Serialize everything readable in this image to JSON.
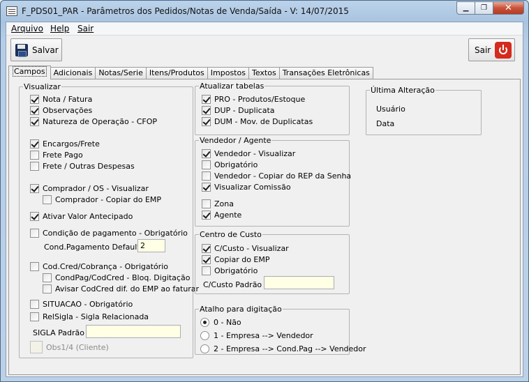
{
  "window": {
    "title": "F_PDS01_PAR - Parâmetros dos Pedidos/Notas de Venda/Saída - V: 14/07/2015",
    "minimize_glyph": "▁",
    "maximize_glyph": "❐",
    "close_glyph": "✕"
  },
  "menu": {
    "file": "Arquivo",
    "help": "Help",
    "exit": "Sair"
  },
  "toolbar": {
    "save_label": "Salvar",
    "exit_label": "Sair"
  },
  "tabs": [
    "Campos",
    "Adicionais",
    "Notas/Serie",
    "Itens/Produtos",
    "Impostos",
    "Textos",
    "Transações Eletrônicas"
  ],
  "visualizar": {
    "legend": "Visualizar",
    "items": [
      {
        "label": "Nota / Fatura",
        "checked": true
      },
      {
        "label": "Observações",
        "checked": true
      },
      {
        "label": "Natureza de Operação - CFOP",
        "checked": true
      },
      {
        "label": "Encargos/Frete",
        "checked": true
      },
      {
        "label": "Frete Pago",
        "checked": false
      },
      {
        "label": "Frete / Outras Despesas",
        "checked": false
      },
      {
        "label": "Comprador / OS - Visualizar",
        "checked": true
      },
      {
        "label": "Comprador - Copiar do EMP",
        "checked": false
      },
      {
        "label": "Ativar Valor Antecipado",
        "checked": true
      },
      {
        "label": "Condição de pagamento - Obrigatório",
        "checked": false
      },
      {
        "label": "Cod.Cred/Cobrança - Obrigatório",
        "checked": false
      },
      {
        "label": "CondPag/CodCred - Bloq. Digitação",
        "checked": false
      },
      {
        "label": "Avisar CodCred dif. do EMP ao faturar",
        "checked": false
      },
      {
        "label": "SITUACAO - Obrigatório",
        "checked": false
      },
      {
        "label": "RelSigla - Sigla Relacionada",
        "checked": false
      },
      {
        "label": "Obs1/4 (Cliente)",
        "checked": false
      }
    ],
    "cond_pagamento_label": "Cond.Pagamento Default",
    "cond_pagamento_value": "2",
    "sigla_label": "SIGLA Padrão",
    "sigla_value": ""
  },
  "atualizar": {
    "legend": "Atualizar tabelas",
    "items": [
      {
        "label": "PRO - Produtos/Estoque",
        "checked": true
      },
      {
        "label": "DUP - Duplicata",
        "checked": true
      },
      {
        "label": "DUM - Mov. de Duplicatas",
        "checked": true
      }
    ]
  },
  "vendedor": {
    "legend": "Vendedor / Agente",
    "items": [
      {
        "label": "Vendedor - Visualizar",
        "checked": true
      },
      {
        "label": "Obrigatório",
        "checked": false
      },
      {
        "label": "Vendedor - Copiar do REP da Senha",
        "checked": false
      },
      {
        "label": "Visualizar Comissão",
        "checked": true
      },
      {
        "label": "Zona",
        "checked": false
      },
      {
        "label": "Agente",
        "checked": true
      }
    ]
  },
  "centro_custo": {
    "legend": "Centro de Custo",
    "items": [
      {
        "label": "C/Custo - Visualizar",
        "checked": true
      },
      {
        "label": "Copiar do EMP",
        "checked": true
      },
      {
        "label": "Obrigatório",
        "checked": false
      }
    ],
    "padrao_label": "C/Custo Padrão",
    "padrao_value": ""
  },
  "atalho": {
    "legend": "Atalho para digitação",
    "options": [
      {
        "label": "0 - Não",
        "selected": true
      },
      {
        "label": "1 - Empresa --> Vendedor",
        "selected": false
      },
      {
        "label": "2 - Empresa --> Cond.Pag --> Vendedor",
        "selected": false
      }
    ]
  },
  "ultima_alteracao": {
    "legend": "Última Alteração",
    "usuario_label": "Usuário",
    "data_label": "Data"
  },
  "icons": {
    "app": "form-icon",
    "save": "floppy-disk-icon",
    "exit": "power-icon"
  }
}
